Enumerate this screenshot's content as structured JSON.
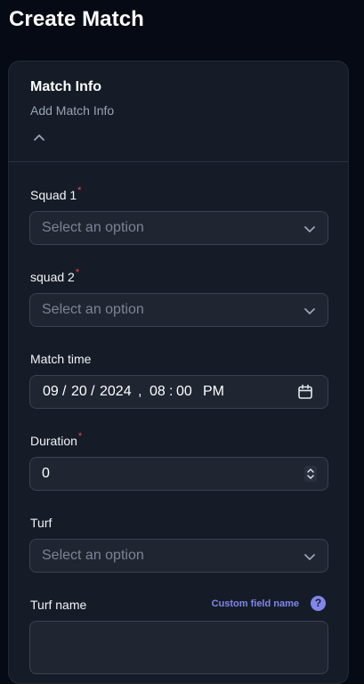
{
  "page": {
    "title": "Create Match"
  },
  "section": {
    "title": "Match Info",
    "subtitle": "Add Match Info"
  },
  "fields": {
    "squad1": {
      "label": "Squad 1",
      "required_mark": "*",
      "placeholder": "Select an option"
    },
    "squad2": {
      "label": "squad 2",
      "required_mark": "*",
      "placeholder": "Select an option"
    },
    "match_time": {
      "label": "Match time",
      "month": "09",
      "day": "20",
      "year": "2024",
      "sep": "/",
      "comma": ",",
      "hour": "08",
      "time_sep": ":",
      "minute": "00",
      "ampm": "PM"
    },
    "duration": {
      "label": "Duration",
      "required_mark": "*",
      "value": "0"
    },
    "turf": {
      "label": "Turf",
      "placeholder": "Select an option"
    },
    "turf_name": {
      "label": "Turf name",
      "custom_field_link": "Custom field name",
      "help_glyph": "?"
    }
  },
  "icons": {
    "collapse": "chevron-up-icon",
    "select": "chevron-down-icon",
    "calendar": "calendar-icon",
    "spinner": "spinner-arrows-icon",
    "help": "question-circle-icon"
  },
  "colors": {
    "background": "#050a14",
    "card": "#161c27",
    "input_bg": "#1f2531",
    "input_border": "#3a4150",
    "required": "#ef4444",
    "accent": "#7f86ec",
    "muted_text": "#9aa3b2"
  }
}
